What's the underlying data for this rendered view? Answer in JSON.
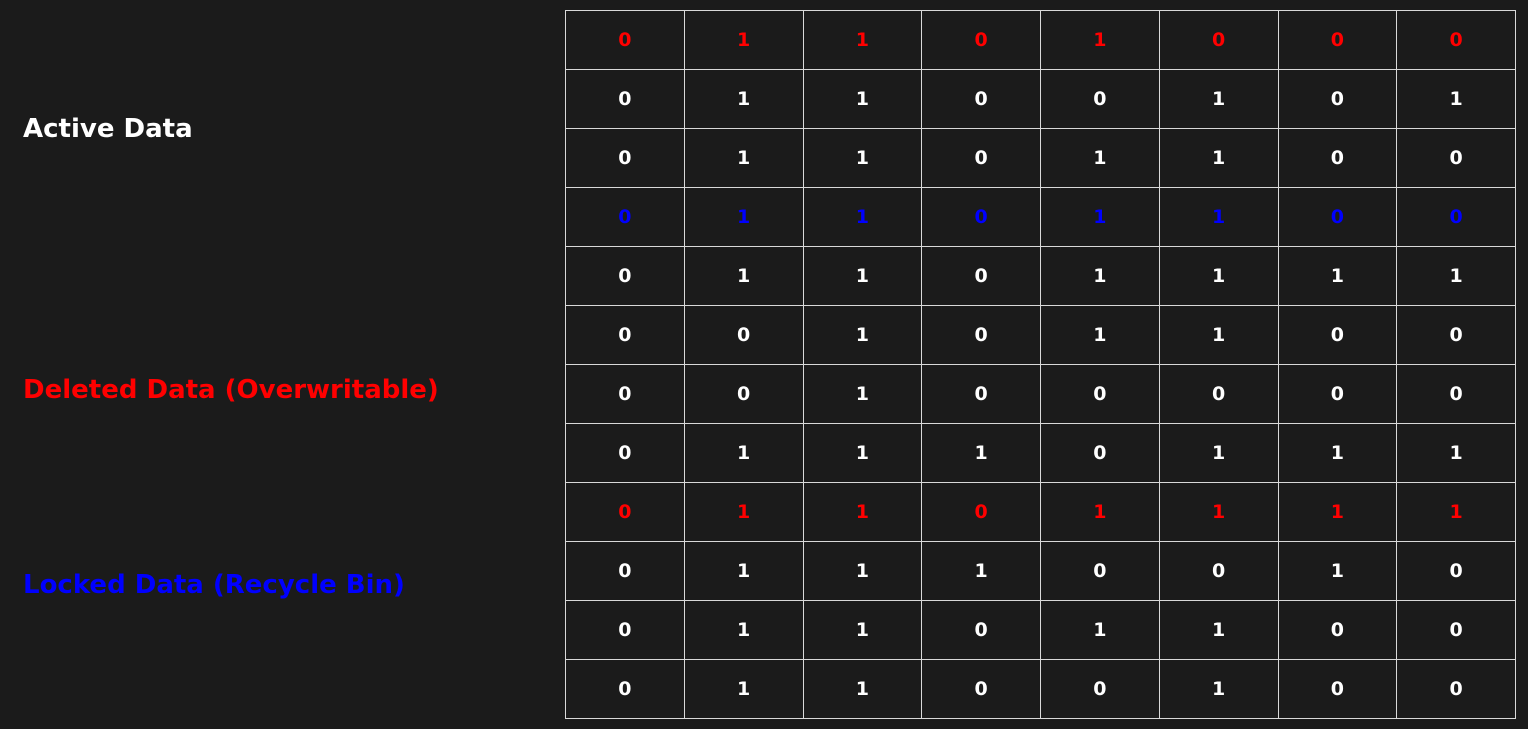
{
  "legend": [
    {
      "id": "active",
      "label": "Active Data",
      "color": "#ffffff"
    },
    {
      "id": "deleted",
      "label": "Deleted Data (Overwritable)",
      "color": "#ff0000"
    },
    {
      "id": "locked",
      "label": "Locked Data (Recycle Bin)",
      "color": "#0000ff"
    }
  ],
  "grid": {
    "rows": [
      {
        "status": "deleted",
        "bits": [
          0,
          1,
          1,
          0,
          1,
          0,
          0,
          0
        ]
      },
      {
        "status": "active",
        "bits": [
          0,
          1,
          1,
          0,
          0,
          1,
          0,
          1
        ]
      },
      {
        "status": "active",
        "bits": [
          0,
          1,
          1,
          0,
          1,
          1,
          0,
          0
        ]
      },
      {
        "status": "locked",
        "bits": [
          0,
          1,
          1,
          0,
          1,
          1,
          0,
          0
        ]
      },
      {
        "status": "active",
        "bits": [
          0,
          1,
          1,
          0,
          1,
          1,
          1,
          1
        ]
      },
      {
        "status": "active",
        "bits": [
          0,
          0,
          1,
          0,
          1,
          1,
          0,
          0
        ]
      },
      {
        "status": "active",
        "bits": [
          0,
          0,
          1,
          0,
          0,
          0,
          0,
          0
        ]
      },
      {
        "status": "active",
        "bits": [
          0,
          1,
          1,
          1,
          0,
          1,
          1,
          1
        ]
      },
      {
        "status": "deleted",
        "bits": [
          0,
          1,
          1,
          0,
          1,
          1,
          1,
          1
        ]
      },
      {
        "status": "active",
        "bits": [
          0,
          1,
          1,
          1,
          0,
          0,
          1,
          0
        ]
      },
      {
        "status": "active",
        "bits": [
          0,
          1,
          1,
          0,
          1,
          1,
          0,
          0
        ]
      },
      {
        "status": "active",
        "bits": [
          0,
          1,
          1,
          0,
          0,
          1,
          0,
          0
        ]
      }
    ]
  }
}
